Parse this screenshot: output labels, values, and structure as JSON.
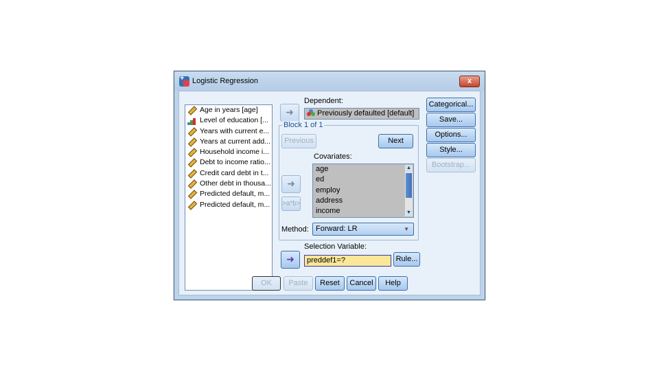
{
  "window": {
    "title": "Logistic Regression",
    "close": "x"
  },
  "variables": [
    {
      "label": "Age in years [age]",
      "icon": "scale-ruler-icon"
    },
    {
      "label": "Level of education [...",
      "icon": "ordinal-bars-icon"
    },
    {
      "label": "Years with current e...",
      "icon": "scale-ruler-icon"
    },
    {
      "label": "Years at current add...",
      "icon": "scale-ruler-icon"
    },
    {
      "label": "Household income i...",
      "icon": "scale-ruler-icon"
    },
    {
      "label": "Debt to income ratio...",
      "icon": "scale-ruler-icon"
    },
    {
      "label": "Credit card debt in t...",
      "icon": "scale-ruler-icon"
    },
    {
      "label": "Other debt in thousa...",
      "icon": "scale-ruler-icon"
    },
    {
      "label": "Predicted default, m...",
      "icon": "scale-ruler-icon"
    },
    {
      "label": "Predicted default, m...",
      "icon": "scale-ruler-icon"
    }
  ],
  "dependent": {
    "label": "Dependent:",
    "value": "Previously defaulted [default]"
  },
  "block": {
    "label": "Block 1 of 1",
    "previous": "Previous",
    "next": "Next"
  },
  "covariates": {
    "label": "Covariates:",
    "items": [
      "age",
      "ed",
      "employ",
      "address",
      "income"
    ],
    "interaction": ">a*b>"
  },
  "method": {
    "label": "Method:",
    "value": "Forward: LR"
  },
  "selection": {
    "label": "Selection Variable:",
    "value": "preddef1=?",
    "rule": "Rule..."
  },
  "side_buttons": {
    "categorical": "Categorical...",
    "save": "Save...",
    "options": "Options...",
    "style": "Style...",
    "bootstrap": "Bootstrap..."
  },
  "footer": {
    "ok": "OK",
    "paste": "Paste",
    "reset": "Reset",
    "cancel": "Cancel",
    "help": "Help"
  }
}
